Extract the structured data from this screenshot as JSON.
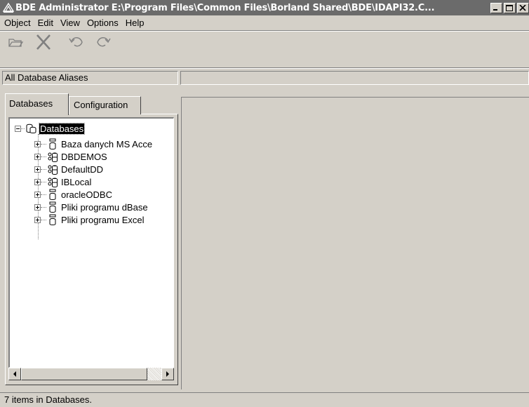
{
  "window": {
    "title": "BDE Administrator  E:\\Program Files\\Common Files\\Borland Shared\\BDE\\IDAPI32.C...",
    "buttons": [
      "minimize-icon",
      "maximize-icon",
      "close-icon"
    ]
  },
  "menu": {
    "items": [
      "Object",
      "Edit",
      "View",
      "Options",
      "Help"
    ]
  },
  "toolbar": {
    "tools": [
      "open-icon",
      "delete-icon",
      "undo-icon",
      "redo-icon"
    ]
  },
  "pathbar": {
    "left": "All Database Aliases",
    "right": ""
  },
  "tabs": {
    "active": "Databases",
    "inactive": "Configuration"
  },
  "tree": {
    "root": "Databases",
    "items": [
      {
        "label": "Baza danych MS Acce",
        "icon": "odbc-database-icon"
      },
      {
        "label": "DBDEMOS",
        "icon": "native-database-icon"
      },
      {
        "label": "DefaultDD",
        "icon": "native-database-icon"
      },
      {
        "label": "IBLocal",
        "icon": "native-database-icon"
      },
      {
        "label": "oracleODBC",
        "icon": "odbc-database-icon"
      },
      {
        "label": "Pliki programu dBase",
        "icon": "odbc-database-icon"
      },
      {
        "label": "Pliki programu Excel",
        "icon": "odbc-database-icon"
      }
    ]
  },
  "status": {
    "text": "7 items in Databases."
  }
}
